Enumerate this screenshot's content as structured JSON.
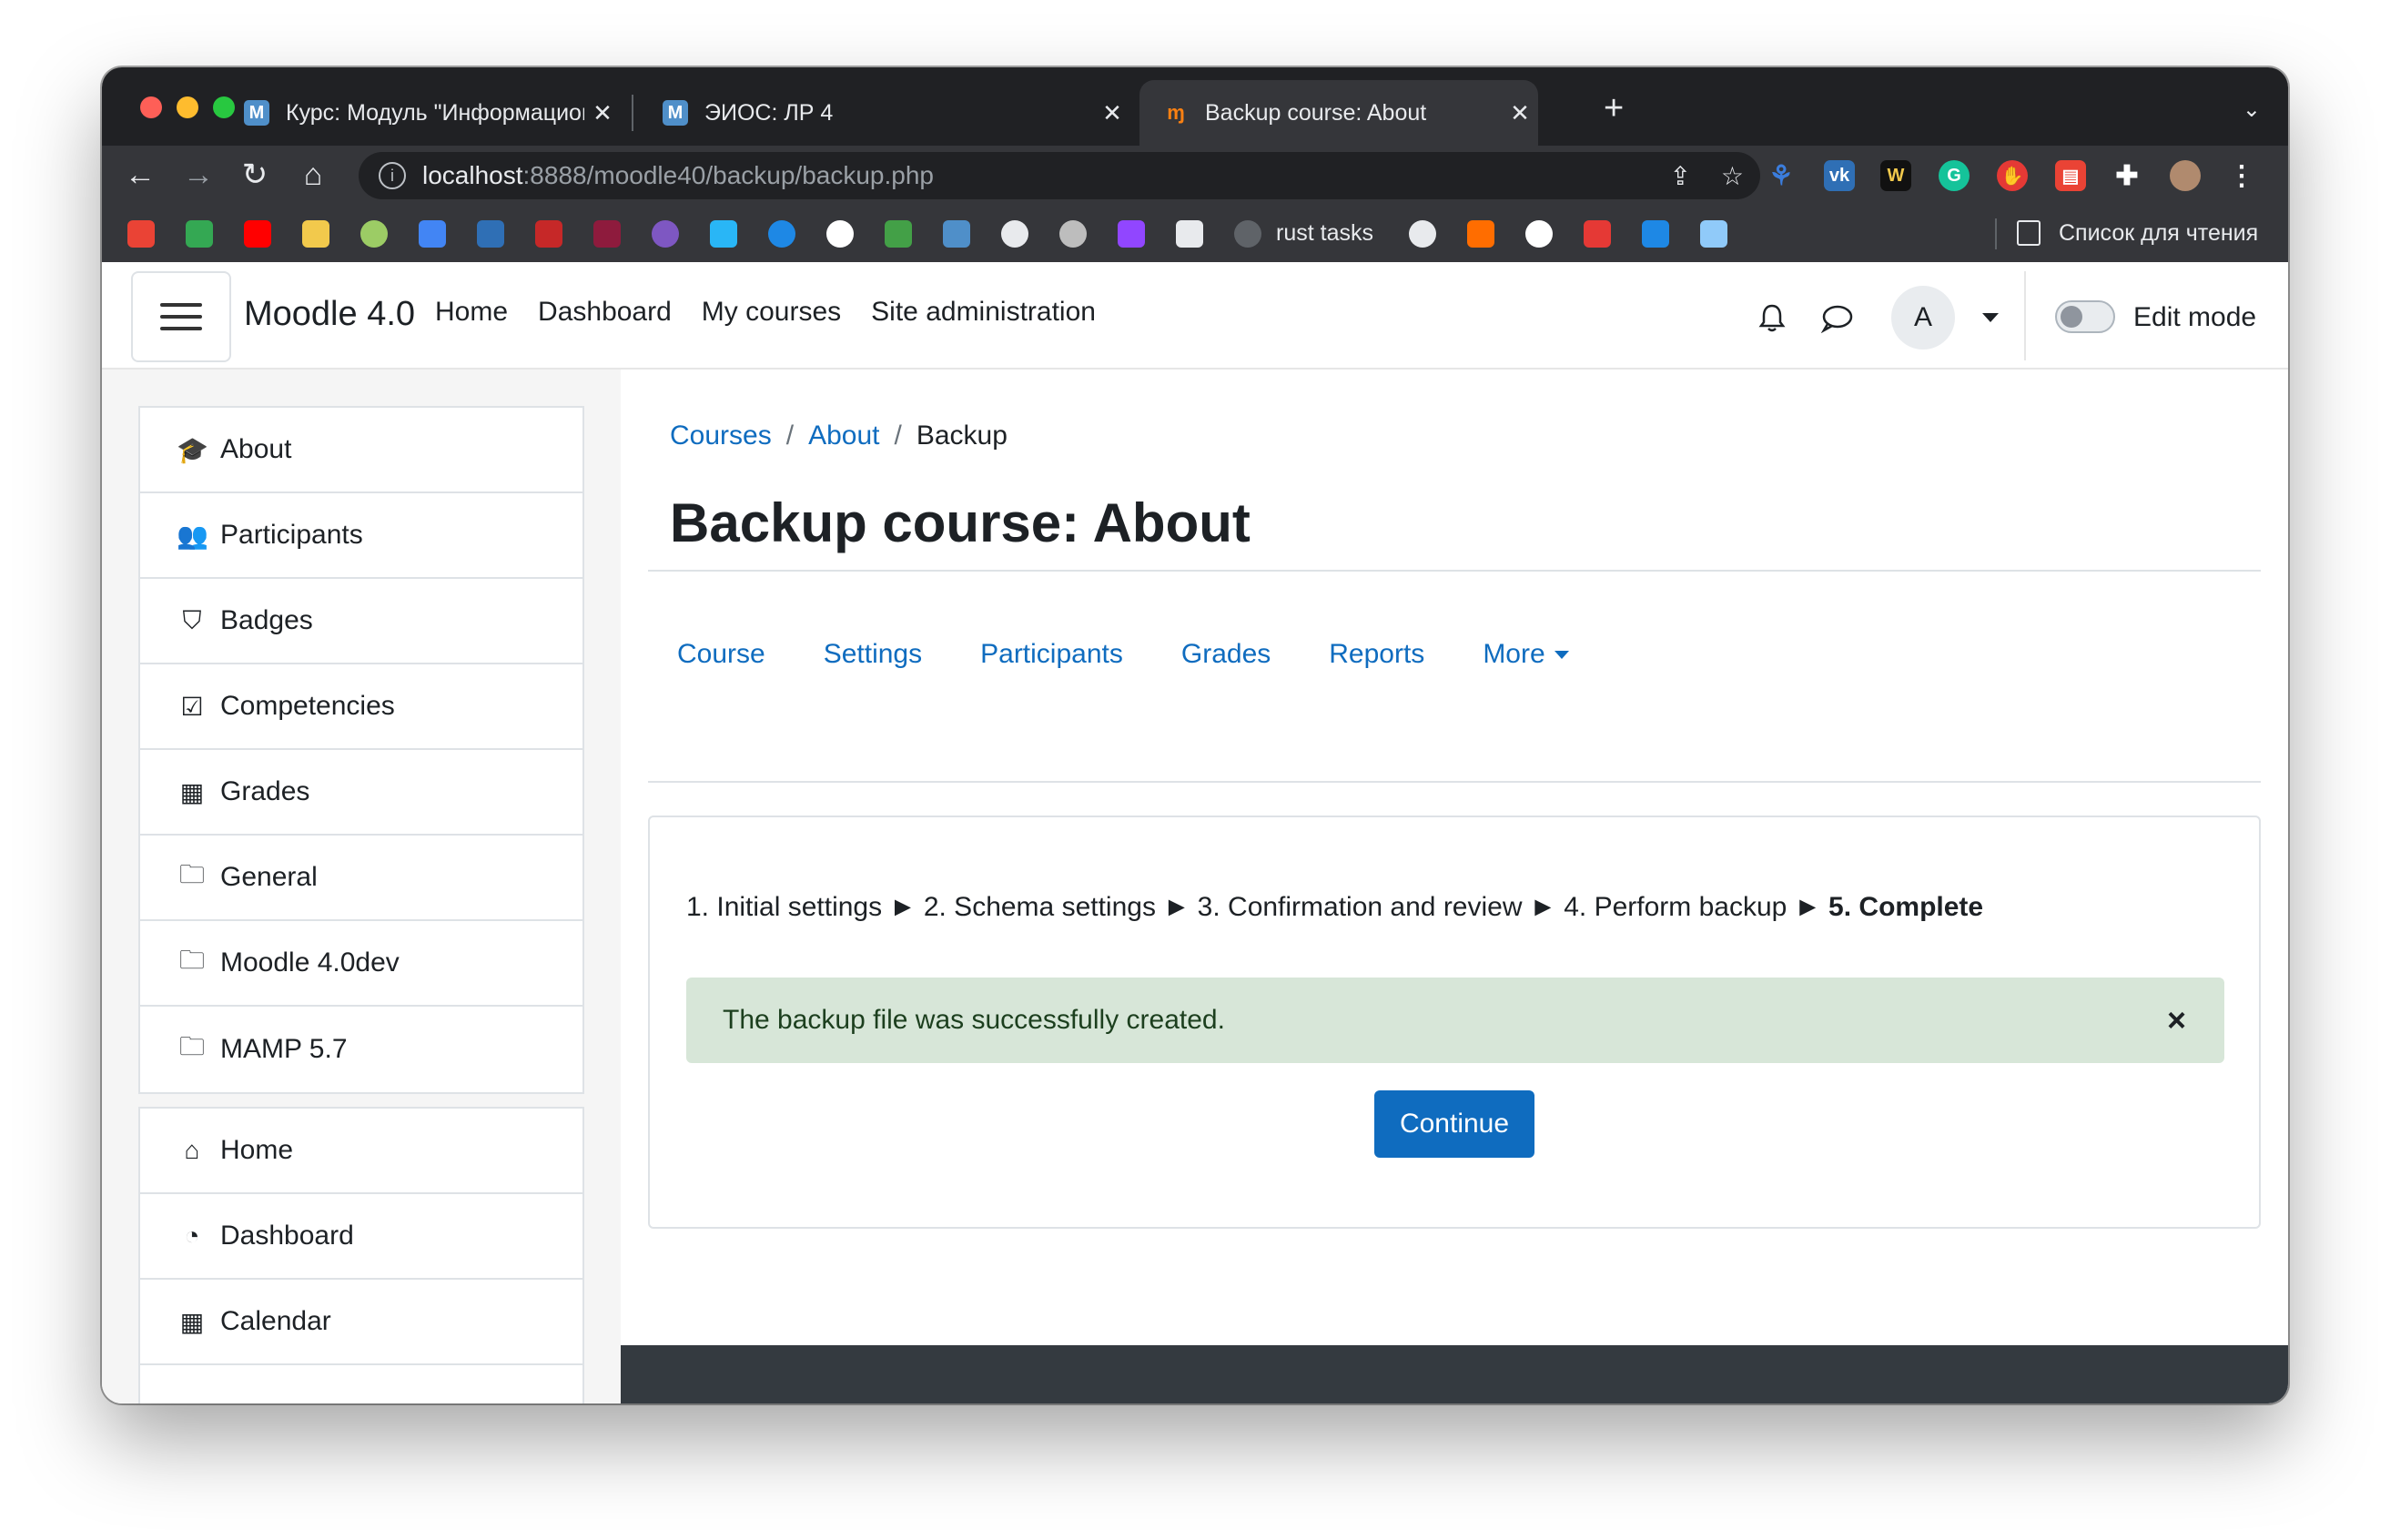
{
  "browser": {
    "tabs": [
      {
        "icon": "M",
        "title": "Курс: Модуль \"Информационн"
      },
      {
        "icon": "M",
        "title": "ЭИОС: ЛР 4"
      },
      {
        "icon": "ɱ",
        "title": "Backup course: About"
      }
    ],
    "url_host": "localhost",
    "url_path": ":8888/moodle40/backup/backup.php",
    "bookmarks": [
      {
        "label": "rust tasks"
      },
      {
        "label": "Список для чтения"
      }
    ]
  },
  "navbar": {
    "brand": "Moodle 4.0",
    "links": [
      "Home",
      "Dashboard",
      "My courses",
      "Site administration"
    ],
    "avatar_initial": "A",
    "edit_mode_label": "Edit mode"
  },
  "drawer": {
    "course_items": [
      {
        "icon": "graduation-cap-icon",
        "label": "About"
      },
      {
        "icon": "users-icon",
        "label": "Participants"
      },
      {
        "icon": "shield-icon",
        "label": "Badges"
      },
      {
        "icon": "checkbox-icon",
        "label": "Competencies"
      },
      {
        "icon": "table-icon",
        "label": "Grades"
      },
      {
        "icon": "folder-icon",
        "label": "General"
      },
      {
        "icon": "folder-icon",
        "label": "Moodle 4.0dev"
      },
      {
        "icon": "folder-icon",
        "label": "MAMP 5.7"
      }
    ],
    "site_items": [
      {
        "icon": "home-icon",
        "label": "Home"
      },
      {
        "icon": "dashboard-icon",
        "label": "Dashboard"
      },
      {
        "icon": "calendar-icon",
        "label": "Calendar"
      }
    ]
  },
  "main": {
    "breadcrumb": [
      "Courses",
      "About",
      "Backup"
    ],
    "title": "Backup course: About",
    "secondary_nav": [
      "Course",
      "Settings",
      "Participants",
      "Grades",
      "Reports",
      "More"
    ],
    "steps": [
      "1. Initial settings",
      "2. Schema settings",
      "3. Confirmation and review",
      "4. Perform backup",
      "5. Complete"
    ],
    "step_separator": "►",
    "alert": "The backup file was successfully created.",
    "alert_close": "×",
    "continue_label": "Continue",
    "help_label": "?"
  },
  "colors": {
    "link": "#0f6cbf",
    "primary_button": "#0f6cbf",
    "success_alert_bg": "#d7e6d8",
    "footer": "#343a40"
  }
}
